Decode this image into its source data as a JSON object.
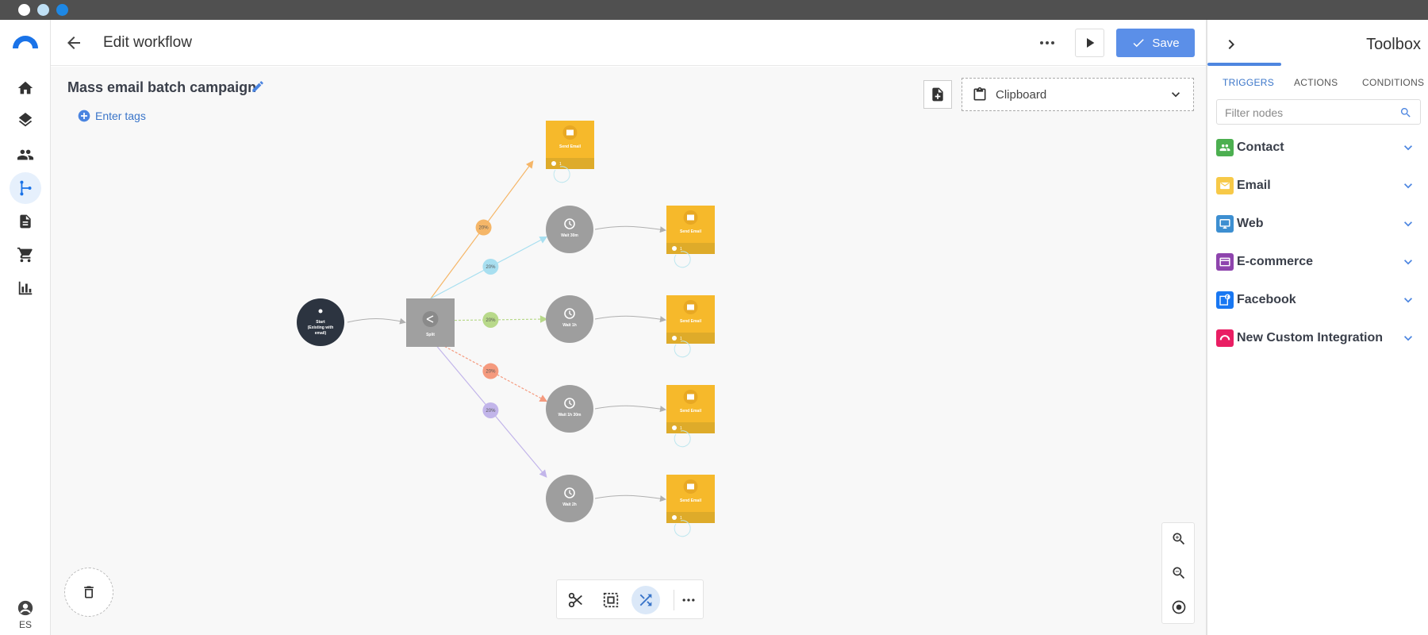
{
  "window": {
    "dots": [
      "#ffffff",
      "#bfe0f5",
      "#1e88e5"
    ]
  },
  "nav": {
    "items": [
      "home-icon",
      "layers-icon",
      "people-icon",
      "workflow-icon",
      "document-icon",
      "cart-icon",
      "bar-chart-icon"
    ],
    "active": "workflow-icon",
    "user_initials": "ES"
  },
  "header": {
    "title": "Edit workflow",
    "save_label": "Save"
  },
  "canvas": {
    "workflow_name": "Mass email batch campaign",
    "tags_label": "Enter tags",
    "clipboard_label": "Clipboard"
  },
  "workflow": {
    "start": {
      "label1": "Start",
      "label2": "(Existing with",
      "label3": "email)"
    },
    "split_label": "Split",
    "branches": [
      {
        "pct": "20%",
        "color": "#f5b668",
        "wait": null,
        "email": "Send Email",
        "count": "1"
      },
      {
        "pct": "20%",
        "color": "#a8dff0",
        "wait": "Wait 30m",
        "email": "Send Email",
        "count": "1"
      },
      {
        "pct": "20%",
        "color": "#b8d98a",
        "wait": "Wait 1h",
        "email": "Send Email",
        "count": "1"
      },
      {
        "pct": "20%",
        "color": "#f59a7e",
        "wait": "Wait 1h 30m",
        "email": "Send Email",
        "count": "1"
      },
      {
        "pct": "20%",
        "color": "#c2b5ea",
        "wait": "Wait 2h",
        "email": "Send Email",
        "count": "1"
      }
    ]
  },
  "toolbox": {
    "title": "Toolbox",
    "tabs": [
      "TRIGGERS",
      "ACTIONS",
      "CONDITIONS"
    ],
    "active_tab": "TRIGGERS",
    "filter_placeholder": "Filter nodes",
    "categories": [
      {
        "label": "Contact",
        "color": "#4caf50",
        "icon": "contact-icon"
      },
      {
        "label": "Email",
        "color": "#f7c948",
        "icon": "email-icon"
      },
      {
        "label": "Web",
        "color": "#3d8fd1",
        "icon": "monitor-icon"
      },
      {
        "label": "E-commerce",
        "color": "#8e44ad",
        "icon": "card-icon"
      },
      {
        "label": "Facebook",
        "color": "#1877f2",
        "icon": "facebook-icon"
      },
      {
        "label": "New Custom Integration",
        "color": "#e91e63",
        "icon": "integration-icon"
      }
    ]
  }
}
